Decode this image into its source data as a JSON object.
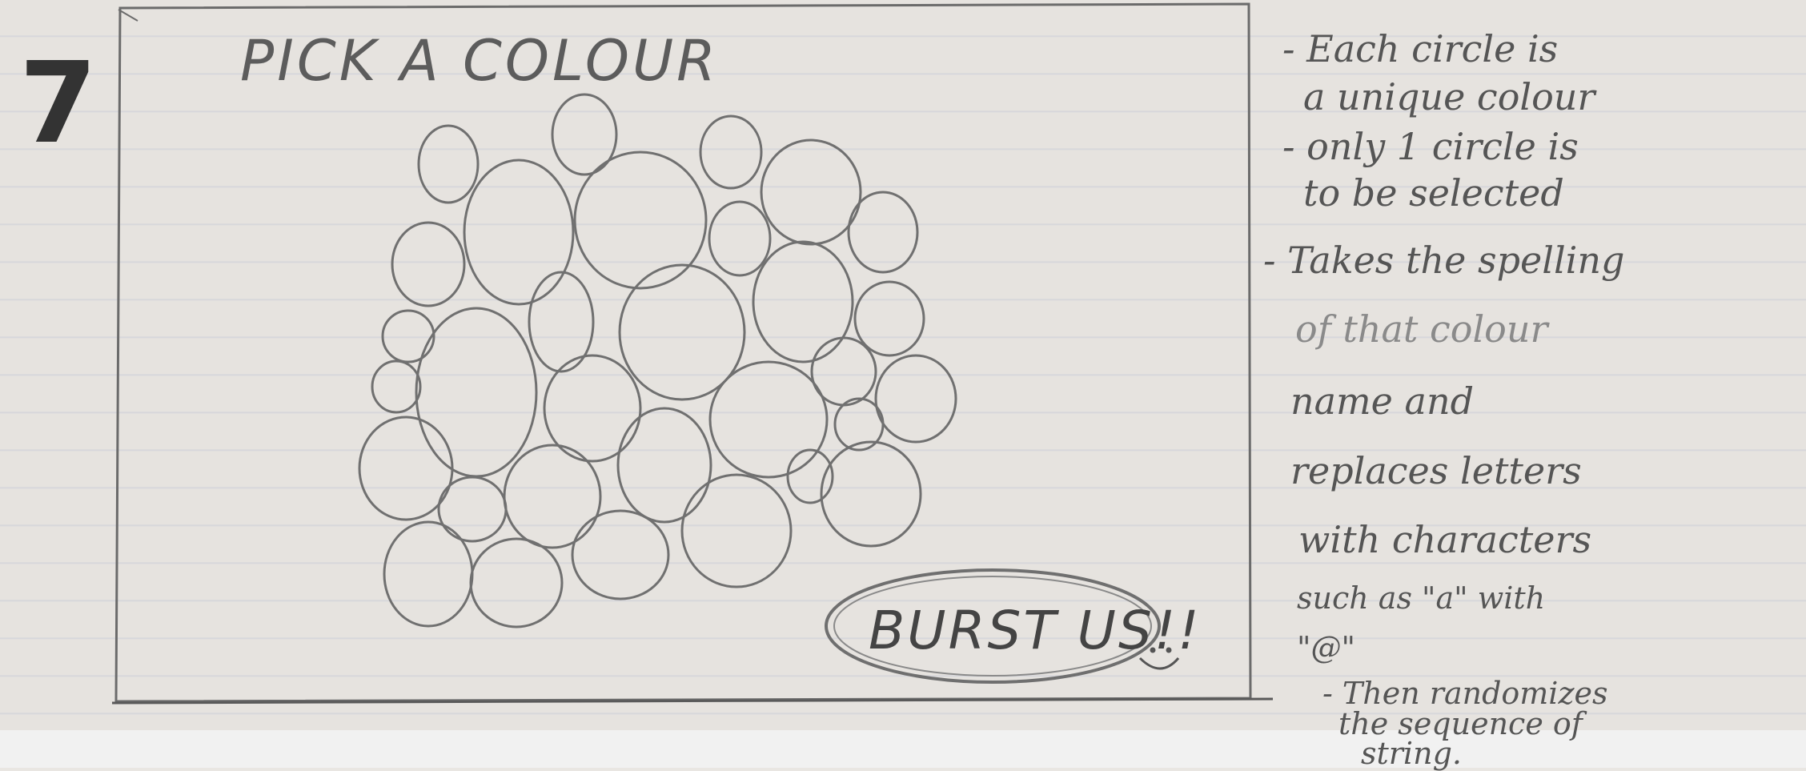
{
  "page_number": "7",
  "sketch": {
    "title": "PICK A COLOUR",
    "burst_button_label": "BURST US!!"
  },
  "notes": [
    "- Each circle is",
    "a unique colour",
    "- only 1 circle is",
    "to be selected",
    "- Takes the spelling",
    "of that colour",
    "name and",
    "replaces letters",
    "with characters",
    "such as \"a\" with",
    "\"@\"",
    "- Then randomizes",
    "the sequence of",
    "string."
  ],
  "colors": {
    "paper": "#e6e3df",
    "ruling": "#d2d3da",
    "pencil": "#6f6f6f",
    "page_number": "#333333"
  }
}
